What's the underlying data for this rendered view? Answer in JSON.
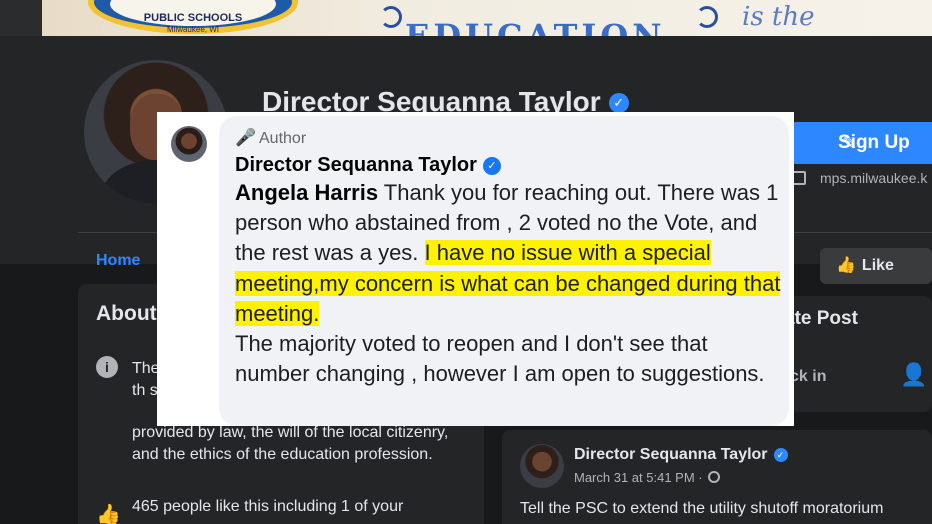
{
  "cover": {
    "logo_line1": "PUBLIC SCHOOLS",
    "logo_line2": "Milwaukee, WI",
    "banner_word": "EDUCATION",
    "banner_tail": "is the"
  },
  "page": {
    "title": "Director Sequanna Taylor",
    "signup_label": "Sign Up",
    "website": "mps.milwaukee.k",
    "nav_home": "Home",
    "like_label": "Like"
  },
  "about": {
    "title": "About",
    "text_top": "The is th syst",
    "text": "provided by law, the will of the local citizenry, and the ethics of the education profession.",
    "likes": "465 people like this including 1 of your"
  },
  "create_post": {
    "title": "ate Post",
    "checkin": "ck in"
  },
  "post": {
    "author": "Director Sequanna Taylor",
    "time": "March 31 at 5:41 PM ·",
    "text": "Tell the PSC to extend the utility shutoff moratorium"
  },
  "comment": {
    "role_tag": "Author",
    "author": "Director Sequanna Taylor",
    "mention": "Angela Harris",
    "text_before": " Thank you for reaching out. There was 1 person who abstained from , 2 voted no the Vote, and the rest was a yes.",
    "text_highlight": "I have no issue with a special meeting,my concern is what can be changed during that meeting.",
    "text_after": "The majority voted to reopen and I don't see that number changing , however I am open to suggestions."
  },
  "colors": {
    "accent": "#2d88ff",
    "highlight": "#fff200",
    "background": "#18191a",
    "card": "#242526"
  },
  "icons": {
    "verified": "check-badge-icon",
    "author": "microphone-icon",
    "info": "info-icon",
    "like": "thumbs-up-icon",
    "edit": "pencil-icon"
  }
}
